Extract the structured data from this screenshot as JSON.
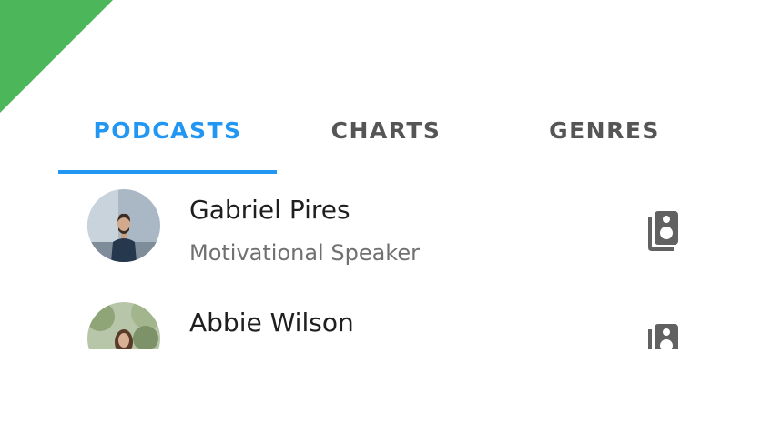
{
  "tabs": [
    {
      "label": "PODCASTS",
      "active": true
    },
    {
      "label": "CHARTS",
      "active": false
    },
    {
      "label": "GENRES",
      "active": false
    }
  ],
  "podcasts": [
    {
      "name": "Gabriel Pires",
      "subtitle": "Motivational Speaker",
      "action_icon": "speaker-library-icon"
    },
    {
      "name": "Abbie Wilson",
      "subtitle": "",
      "action_icon": "speaker-library-icon"
    }
  ],
  "colors": {
    "accent": "#2196f3",
    "corner": "#4cb75a",
    "tab_inactive": "#555555",
    "name_text": "#1f1f1f",
    "subtitle_text": "#707070",
    "icon": "#616161"
  }
}
